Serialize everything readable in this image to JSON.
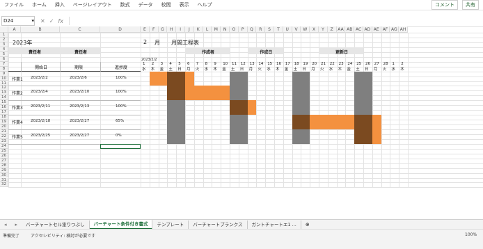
{
  "ribbon": {
    "tabs": [
      "ファイル",
      "ホーム",
      "挿入",
      "ページレイアウト",
      "数式",
      "データ",
      "校閲",
      "表示",
      "ヘルプ"
    ],
    "comment_btn": "コメント",
    "share_btn": "共有"
  },
  "formula_bar": {
    "name_box": "D24",
    "fx": "fx",
    "content": ""
  },
  "sheet": {
    "year": "2023年",
    "month_num": "2",
    "month_label": "月",
    "doc_title": "月間工程表",
    "responsible_label": "責任者",
    "responsible2_label": "責任者",
    "creator_label": "作成者",
    "created_date_label": "作成日",
    "updated_date_label": "更新日",
    "start_date_header": "2023/2/2",
    "col_start": "開始日",
    "col_end": "期限",
    "col_progress": "進捗度",
    "tasks": [
      {
        "name": "作業1",
        "start": "2023/2/2",
        "end": "2023/2/6",
        "progress": "100%"
      },
      {
        "name": "作業2",
        "start": "2023/2/4",
        "end": "2023/2/10",
        "progress": "100%"
      },
      {
        "name": "作業3",
        "start": "2023/2/11",
        "end": "2023/2/13",
        "progress": "100%"
      },
      {
        "name": "作業4",
        "start": "2023/2/18",
        "end": "2023/2/27",
        "progress": "65%"
      },
      {
        "name": "作業5",
        "start": "2023/2/25",
        "end": "2023/2/27",
        "progress": "0%"
      }
    ],
    "days": [
      "1",
      "2",
      "3",
      "4",
      "5",
      "6",
      "7",
      "8",
      "9",
      "10",
      "11",
      "12",
      "13",
      "14",
      "15",
      "16",
      "17",
      "18",
      "19",
      "20",
      "21",
      "22",
      "23",
      "24",
      "25",
      "26",
      "27",
      "28",
      "1",
      "2"
    ],
    "weekdays": [
      "水",
      "木",
      "金",
      "土",
      "日",
      "月",
      "火",
      "水",
      "木",
      "金",
      "土",
      "日",
      "月",
      "火",
      "水",
      "木",
      "金",
      "土",
      "日",
      "月",
      "火",
      "水",
      "木",
      "金",
      "土",
      "日",
      "月",
      "火",
      "水",
      "木"
    ]
  },
  "col_headers": [
    "A",
    "B",
    "C",
    "D",
    "E",
    "F",
    "G",
    "H",
    "I",
    "J",
    "K",
    "L",
    "M",
    "N",
    "O",
    "P",
    "Q",
    "R",
    "S",
    "T",
    "U",
    "V",
    "W",
    "X",
    "Y",
    "Z",
    "AA",
    "AB",
    "AC",
    "AD",
    "AE",
    "AF",
    "AG",
    "AH"
  ],
  "row_headers": [
    "1",
    "2",
    "3",
    "4",
    "5",
    "6",
    "7",
    "8",
    "9",
    "10",
    "11",
    "12",
    "13",
    "14",
    "15",
    "16",
    "17",
    "18",
    "19",
    "20",
    "21",
    "22",
    "23",
    "24",
    "25",
    "26",
    "27",
    "28",
    "29",
    "30",
    "31",
    "32"
  ],
  "sheet_tabs": [
    "バーチャートセル塗りつぶし",
    "バーチャート条件付き書式",
    "テンプレート",
    "バーチャートブランクス",
    "ガントチャートエ1 ..."
  ],
  "active_sheet_index": 1,
  "status": {
    "left": "準備完了",
    "accessibility": "アクセシビリティ: 検討が必要です",
    "zoom": "100%"
  },
  "colors": {
    "bar_orange": "#f4913f",
    "bar_brown": "#7b4a20",
    "weekend_gray": "#7f7f7f",
    "accent_green": "#1d6f3a"
  }
}
